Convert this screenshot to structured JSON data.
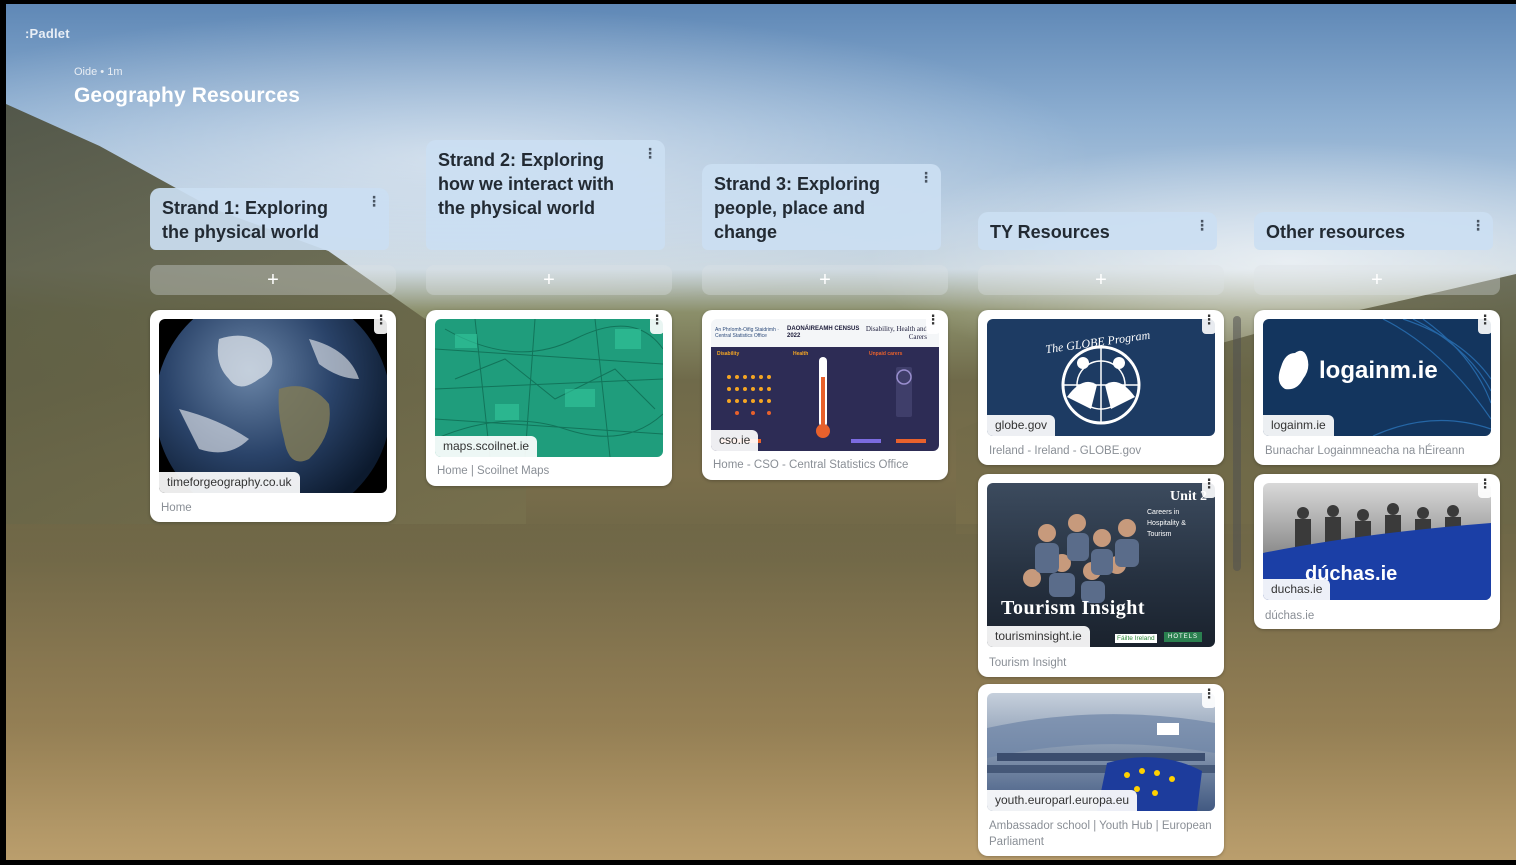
{
  "app": {
    "logo": ":Padlet"
  },
  "board": {
    "meta": "Oide • 1m",
    "title": "Geography Resources"
  },
  "columns": [
    {
      "title": "Strand 1: Exploring the physical world",
      "add": "+"
    },
    {
      "title": "Strand 2: Exploring how we interact with the physical world",
      "add": "+"
    },
    {
      "title": "Strand 3: Exploring people, place and change",
      "add": "+"
    },
    {
      "title": "TY Resources",
      "add": "+"
    },
    {
      "title": "Other resources",
      "add": "+"
    }
  ],
  "cards": {
    "c1": {
      "domain": "timeforgeography.co.uk",
      "subtitle": "Home",
      "menu": "⋮"
    },
    "c2": {
      "domain": "maps.scoilnet.ie",
      "subtitle": "Home | Scoilnet Maps",
      "menu": "⋮"
    },
    "c3": {
      "domain": "cso.ie",
      "subtitle": "Home - CSO - Central Statistics Office",
      "menu": "⋮",
      "image_text": {
        "brand": "An Phríomh-Oifig Staidrimh · Central Statistics Office",
        "census": "DAONÁIREAMH CENSUS 2022",
        "heading": "Disability, Health and Carers",
        "col1": "Disability",
        "col2": "Health",
        "col3": "Unpaid carers"
      }
    },
    "c4": {
      "domain": "globe.gov",
      "subtitle": "Ireland - Ireland - GLOBE.gov",
      "menu": "⋮",
      "image_text": "The GLOBE Program"
    },
    "c5": {
      "domain": "tourisminsight.ie",
      "subtitle": "Tourism Insight",
      "menu": "⋮",
      "image_text": {
        "unit": "Unit 2",
        "unit_sub": "Careers in Hospitality & Tourism",
        "big": "Tourism Insight",
        "partner1": "Fáilte Ireland",
        "partner2": "HOTELS"
      }
    },
    "c6": {
      "domain": "youth.europarl.europa.eu",
      "subtitle": "Ambassador school | Youth Hub | European Parliament",
      "menu": "⋮"
    },
    "c7": {
      "domain": "logainm.ie",
      "subtitle": "Bunachar Logainmneacha na hÉireann",
      "menu": "⋮",
      "image_text": "logainm.ie"
    },
    "c8": {
      "domain": "duchas.ie",
      "subtitle": "dúchas.ie",
      "menu": "⋮",
      "image_text": "dúchas.ie"
    }
  },
  "column_menu": "⋮",
  "colors": {
    "header_bg": "#cbdef2",
    "logainm_bg": "#13355e",
    "duchas_blue": "#1b3fa6",
    "globe_bg": "#1d3b63",
    "scoilnet_bg": "#1f9d7c"
  }
}
